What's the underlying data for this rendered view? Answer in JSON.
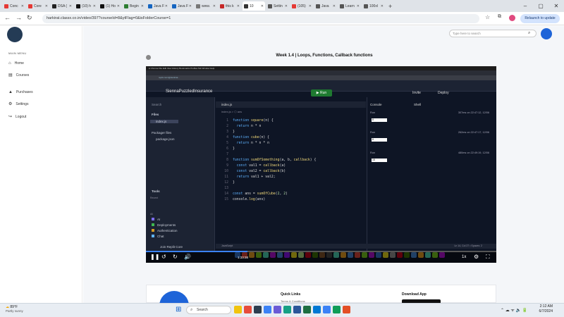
{
  "browser": {
    "tabs": [
      {
        "label": "Conc",
        "color": "#e53935"
      },
      {
        "label": "Core",
        "color": "#e53935"
      },
      {
        "label": "DSA (",
        "color": "#222222"
      },
      {
        "label": "(10) h",
        "color": "#111111"
      },
      {
        "label": "(1) Ho",
        "color": "#111111"
      },
      {
        "label": "Begin",
        "color": "#2e7d32"
      },
      {
        "label": "Java F",
        "color": "#1565c0"
      },
      {
        "label": "Java F",
        "color": "#1565c0"
      },
      {
        "label": "www.",
        "color": "#777777"
      },
      {
        "label": "this k",
        "color": "#c62828"
      },
      {
        "label": "10",
        "color": "#333333",
        "active": true
      },
      {
        "label": "Settin",
        "color": "#555555"
      },
      {
        "label": "(105)",
        "color": "#e53935"
      },
      {
        "label": "Java",
        "color": "#555555"
      },
      {
        "label": "Learn",
        "color": "#555555"
      },
      {
        "label": "100xl",
        "color": "#555555"
      }
    ],
    "url": "harkirat.classx.co.in/video/397?courseId=8&ytFlag=0&isFolderCourse=1",
    "relaunch_label": "Relaunch to update"
  },
  "site": {
    "menu_header": "MAIN MENU",
    "nav": [
      {
        "label": "Home",
        "icon": "home-icon",
        "glyph": "⌂"
      },
      {
        "label": "Courses",
        "icon": "book-icon",
        "glyph": "▤"
      },
      {
        "label": "Purchases",
        "icon": "purchase-icon",
        "glyph": "▲"
      },
      {
        "label": "Settings",
        "icon": "gear-icon",
        "glyph": "⚙"
      },
      {
        "label": "Logout",
        "icon": "logout-icon",
        "glyph": "↪"
      }
    ],
    "search_placeholder": "Type here to search",
    "video_title": "Week 1.4 | Loops, Functions, Callback functions"
  },
  "replit": {
    "project_name": "SiennaPuzzledInsurance",
    "run_label": "Run",
    "invite_label": "Invite",
    "deploy_label": "Deploy",
    "files_label": "Files",
    "file_active": "index.js",
    "packager_label": "Packager files",
    "package_file": "package.json",
    "tools_label": "Tools",
    "recent_label": "Recent",
    "all_label": "All",
    "tools": [
      "AI",
      "Deployments",
      "Authentication",
      "Chat"
    ],
    "join_label": "Join Replit Core",
    "editor_tab": "index.js",
    "breadcrumb": "index.js > ⬡ ans",
    "code": [
      "function square(n) {",
      "  return n * n",
      "}",
      "function cube(n) {",
      "  return n * n * n",
      "}",
      "",
      "function sumOfSomething(a, b, callback) {",
      "  const val1 = callback(a)",
      "  const val2 = callback(b)",
      "  return val1 + val2;",
      "}",
      "",
      "const ans = sumOfCube(2, 2)",
      "console.log(ans)"
    ],
    "console_tab": "Console",
    "shell_tab": "Shell",
    "runs": [
      {
        "label": "Run",
        "meta": "307ms on 22:47:12, 12/06",
        "output": "8"
      },
      {
        "label": "Run",
        "meta": "262ms on 22:47:17, 12/06",
        "output": "8"
      },
      {
        "label": "Run",
        "meta": "480ms on 22:49:19, 12/06",
        "output": "16"
      }
    ],
    "status_left": "JavaScript",
    "status_right": "Ln 14, Col 27  •  Spaces: 2"
  },
  "video": {
    "time": "1:33:38",
    "speed": "1x",
    "progress": 0.29
  },
  "footer": {
    "quick_links": "Quick Links",
    "quick_sub": "Terms & Conditions",
    "download_app": "Download App"
  },
  "taskbar": {
    "temp": "89°F",
    "weather": "Partly sunny",
    "search": "Search",
    "time": "2:12 AM",
    "date": "6/7/2024"
  }
}
